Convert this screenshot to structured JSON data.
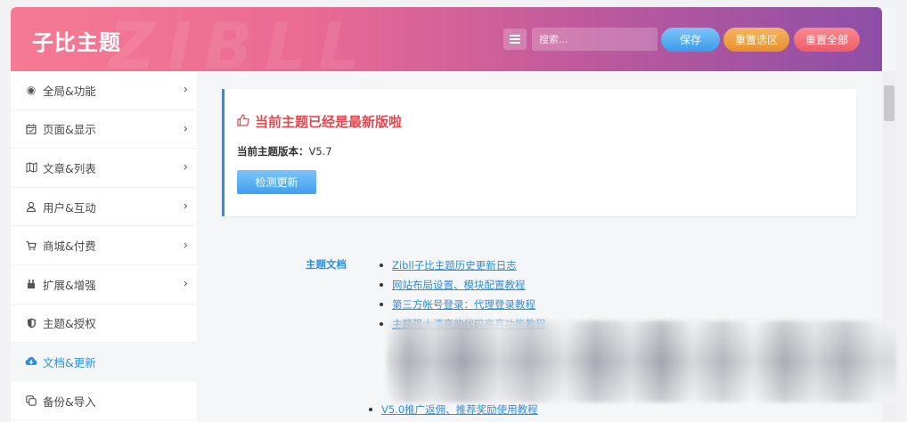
{
  "header": {
    "title": "子比主题",
    "watermark": "ZIBLL",
    "search_placeholder": "搜索...",
    "save_label": "保存",
    "reset_selection_label": "重置选区",
    "reset_all_label": "重置全部"
  },
  "sidebar": {
    "items": [
      {
        "label": "全局&功能",
        "icon": "circle-dot-icon",
        "chevron": "›"
      },
      {
        "label": "页面&显示",
        "icon": "calendar-check-icon",
        "chevron": "›"
      },
      {
        "label": "文章&列表",
        "icon": "map-icon",
        "chevron": "›"
      },
      {
        "label": "用户&互动",
        "icon": "user-icon",
        "chevron": "›"
      },
      {
        "label": "商城&付费",
        "icon": "cart-icon",
        "chevron": "›"
      },
      {
        "label": "扩展&增强",
        "icon": "plugin-icon",
        "chevron": "›"
      },
      {
        "label": "主题&授权",
        "icon": "shield-icon",
        "chevron": ""
      },
      {
        "label": "文档&更新",
        "icon": "cloud-download-icon",
        "chevron": ""
      },
      {
        "label": "备份&导入",
        "icon": "copy-icon",
        "chevron": ""
      }
    ]
  },
  "update": {
    "title": "当前主题已经是最新版啦",
    "version_label": "当前主题版本：",
    "version_value": "V5.7",
    "check_button": "检测更新"
  },
  "docs": {
    "label": "主题文档",
    "links": [
      "Zibll子比主题历史更新日志",
      "网站布局设置、模块配置教程",
      "第三方帐号登录：代理登录教程",
      "主题强大漂亮的代码高亮功能教程"
    ],
    "last_link": "V5.0推广返佣、推荐奖励使用教程"
  },
  "colors": {
    "accent": "#2f8fdf",
    "alert": "#e6474d",
    "header_start": "#f67a93",
    "header_end": "#8d4fa7"
  }
}
